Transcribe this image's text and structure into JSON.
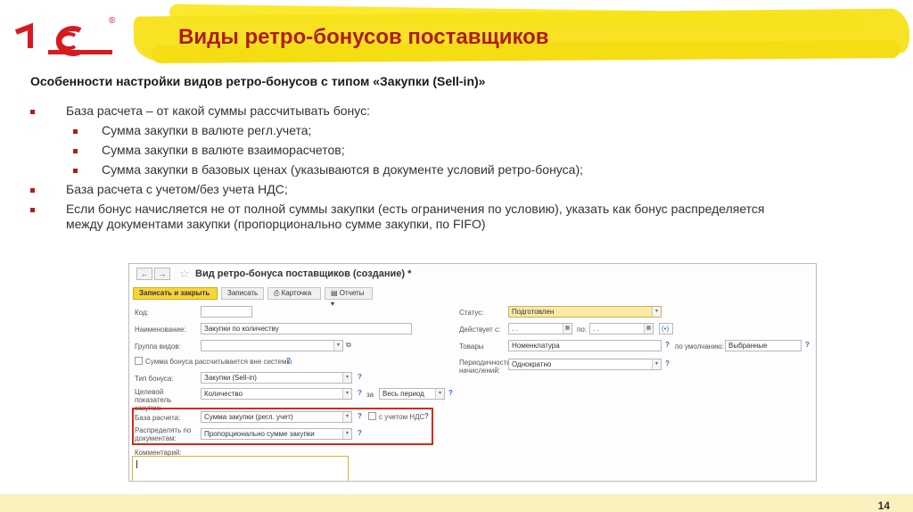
{
  "logo": {
    "text": "1С",
    "reg": "®"
  },
  "slide": {
    "title": "Виды ретро-бонусов поставщиков",
    "subtitle": "Особенности настройки видов ретро-бонусов с типом «Закупки (Sell-in)»",
    "page_number": "14"
  },
  "bullets": [
    {
      "level": 1,
      "text": "База расчета – от какой суммы рассчитывать бонус:"
    },
    {
      "level": 2,
      "text": "Сумма закупки в валюте регл.учета;"
    },
    {
      "level": 2,
      "text": "Сумма закупки в валюте взаиморасчетов;"
    },
    {
      "level": 2,
      "text": "Сумма закупки в базовых ценах (указываются в документе условий ретро-бонуса);"
    },
    {
      "level": 1,
      "text": "База расчета с учетом/без учета НДС;"
    },
    {
      "level": 1,
      "text": "Если бонус начисляется не от полной суммы закупки (есть ограничения по условию), указать как бонус распределяется между документами закупки (пропорционально сумме закупки, по FIFO)"
    }
  ],
  "form": {
    "nav_back": "←",
    "nav_forward": "→",
    "star": "☆",
    "title": "Вид ретро-бонуса поставщиков (создание) *",
    "toolbar": {
      "save_close": "Записать и закрыть",
      "save": "Записать",
      "card": "Карточка",
      "reports": "Отчеты"
    },
    "labels": {
      "code": "Код:",
      "name": "Наименование:",
      "group": "Группа видов:",
      "outside_system": "Сумма бонуса рассчитывается вне системы",
      "bonus_type": "Тип бонуса:",
      "target_indicator": "Целевой показатель закупок:",
      "for": "за",
      "calc_base": "База расчета:",
      "vat": "с учетом НДС",
      "distribute": "Распределять по документам:",
      "comment": "Комментарий:",
      "status": "Статус:",
      "valid_from": "Действует с:",
      "to": "по:",
      "goods": "Товары",
      "default": "по умолчанию:",
      "periodicity": "Периодичность начислений:"
    },
    "values": {
      "code": "",
      "name": "Закупки по количеству",
      "group": "",
      "bonus_type": "Закупки (Sell-in)",
      "target_indicator": "Количество",
      "period": "Весь период",
      "calc_base": "Сумма закупки (регл. учет)",
      "distribute": "Пропорционально сумме закупки",
      "status": "Подготовлен",
      "date_from": ". .",
      "date_to": ". .",
      "goods": "Номенклатура",
      "default": "Выбранные",
      "periodicity": "Однократно"
    },
    "help": "?"
  }
}
